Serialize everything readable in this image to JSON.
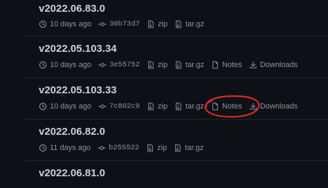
{
  "releases": [
    {
      "tag": "v2022.06.83.0",
      "age": "10 days ago",
      "commit": "30b73d7",
      "zip": "zip",
      "targz": "tar.gz"
    },
    {
      "tag": "v2022.05.103.34",
      "age": "10 days ago",
      "commit": "3e55752",
      "zip": "zip",
      "targz": "tar.gz",
      "notes": "Notes",
      "downloads": "Downloads"
    },
    {
      "tag": "v2022.05.103.33",
      "age": "10 days ago",
      "commit": "7c802c9",
      "zip": "zip",
      "targz": "tar.gz",
      "notes": "Notes",
      "downloads": "Downloads"
    },
    {
      "tag": "v2022.06.82.0",
      "age": "11 days ago",
      "commit": "b255522",
      "zip": "zip",
      "targz": "tar.gz"
    },
    {
      "tag": "v2022.06.81.0"
    }
  ],
  "icons": {
    "clock": "clock-icon",
    "commit": "git-commit-icon",
    "zip": "file-zip-icon",
    "tar": "file-zip-icon",
    "notes": "file-icon",
    "download": "download-icon"
  },
  "colors": {
    "background": "#0d1117",
    "text": "#c9d1d9",
    "muted": "#8b949e",
    "divider": "#21262d",
    "annotation": "#e0262b"
  }
}
